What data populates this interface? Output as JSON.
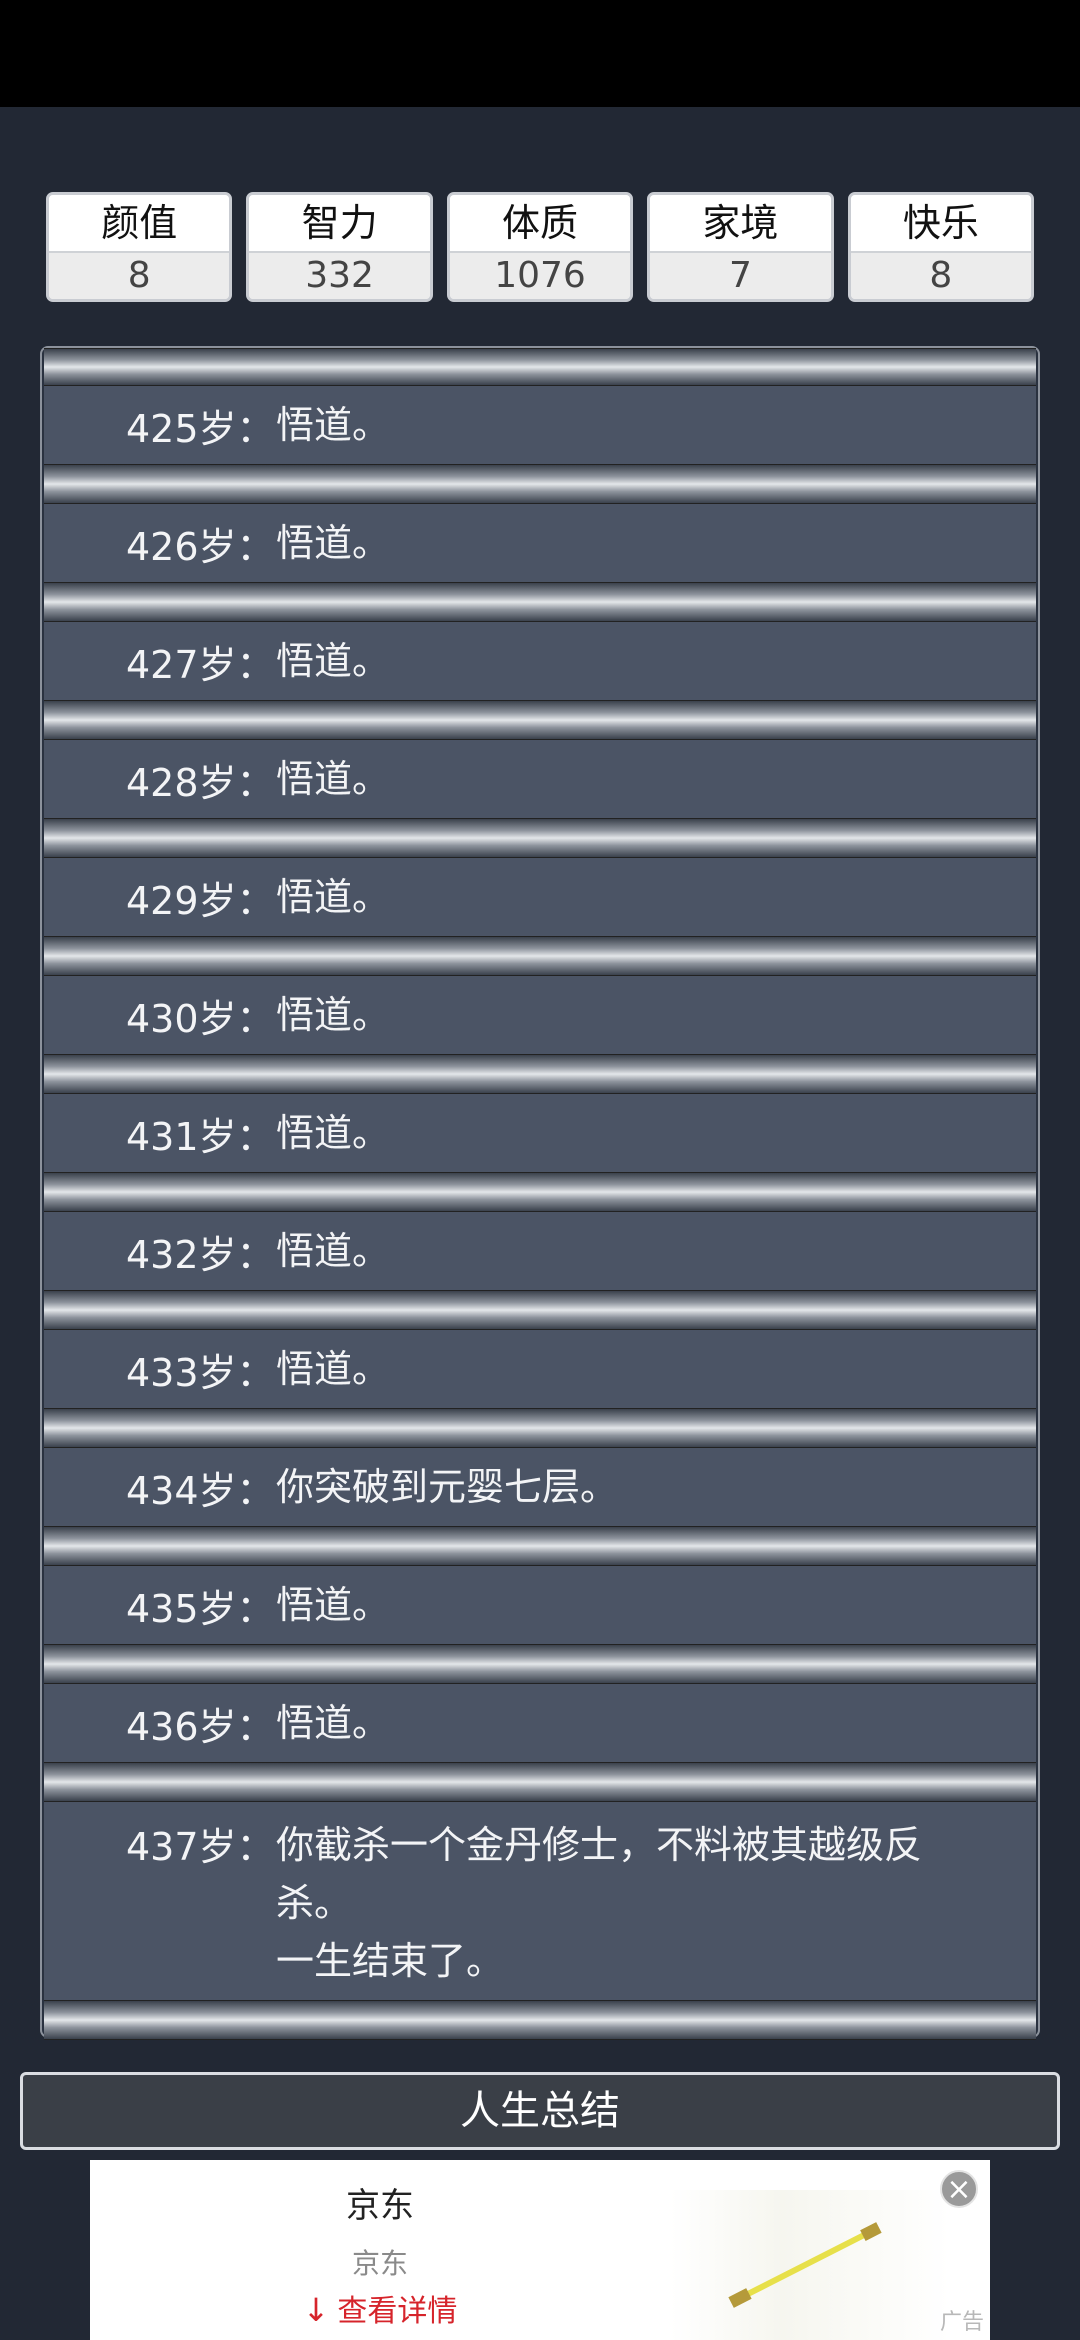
{
  "stats": [
    {
      "name": "颜值",
      "value": "8"
    },
    {
      "name": "智力",
      "value": "332"
    },
    {
      "name": "体质",
      "value": "1076"
    },
    {
      "name": "家境",
      "value": "7"
    },
    {
      "name": "快乐",
      "value": "8"
    }
  ],
  "log": [
    {
      "age": "425岁：",
      "lines": [
        "悟道。"
      ]
    },
    {
      "age": "426岁：",
      "lines": [
        "悟道。"
      ]
    },
    {
      "age": "427岁：",
      "lines": [
        "悟道。"
      ]
    },
    {
      "age": "428岁：",
      "lines": [
        "悟道。"
      ]
    },
    {
      "age": "429岁：",
      "lines": [
        "悟道。"
      ]
    },
    {
      "age": "430岁：",
      "lines": [
        "悟道。"
      ]
    },
    {
      "age": "431岁：",
      "lines": [
        "悟道。"
      ]
    },
    {
      "age": "432岁：",
      "lines": [
        "悟道。"
      ]
    },
    {
      "age": "433岁：",
      "lines": [
        "悟道。"
      ]
    },
    {
      "age": "434岁：",
      "lines": [
        "你突破到元婴七层。"
      ]
    },
    {
      "age": "435岁：",
      "lines": [
        "悟道。"
      ]
    },
    {
      "age": "436岁：",
      "lines": [
        "悟道。"
      ]
    },
    {
      "age": "437岁：",
      "lines": [
        "你截杀一个金丹修士，不料被其越级反杀。",
        "一生结束了。"
      ]
    }
  ],
  "summary_button": "人生总结",
  "ad": {
    "title": "京东",
    "subtitle": "京东",
    "cta": "查看详情",
    "cta_icon": "download-arrow-icon",
    "close_icon": "close-icon",
    "tag": "广告"
  }
}
